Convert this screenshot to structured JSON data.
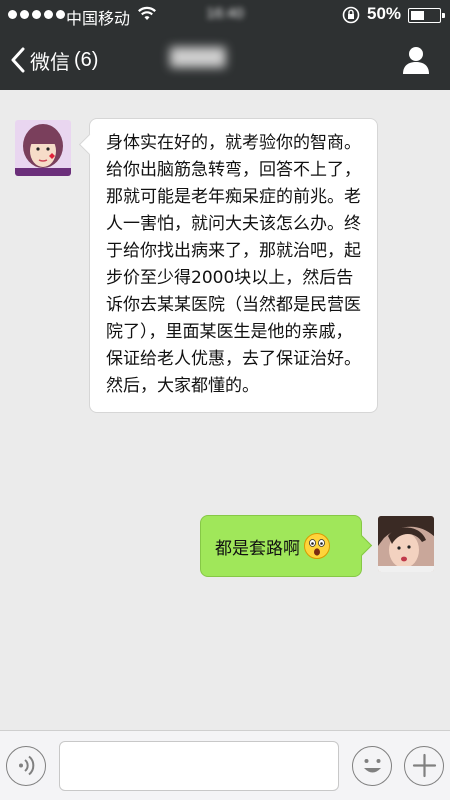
{
  "status_bar": {
    "carrier": "中国移动",
    "time": "16:40",
    "battery_percent": "50%",
    "battery_level": 0.5,
    "icons": [
      "signal-dots-icon",
      "wifi-icon",
      "orientation-lock-icon",
      "battery-icon"
    ]
  },
  "nav": {
    "back_label": "微信",
    "unread_count": "(6)",
    "title": "████",
    "icons": [
      "chevron-left-icon",
      "contact-profile-icon"
    ]
  },
  "messages": [
    {
      "direction": "incoming",
      "text": "身体实在好的，就考验你的智商。给你出脑筋急转弯，回答不上了，那就可能是老年痴呆症的前兆。老人一害怕，就问大夫该怎么办。终于给你找出病来了，那就治吧，起步价至少得2000块以上，然后告诉你去某某医院（当然都是民营医院了），里面某医生是他的亲戚，保证给老人优惠，去了保证治好。然后，大家都懂的。"
    },
    {
      "direction": "outgoing",
      "text": "都是套路啊",
      "emoji": "surprised-face-icon"
    }
  ],
  "input_bar": {
    "placeholder": "",
    "value": "",
    "icons": [
      "voice-icon",
      "emoji-icon",
      "plus-icon"
    ]
  },
  "colors": {
    "bar_bg": "#2e3132",
    "chat_bg": "#ebebeb",
    "outgoing_bubble": "#a0e75a",
    "incoming_bubble": "#ffffff"
  }
}
